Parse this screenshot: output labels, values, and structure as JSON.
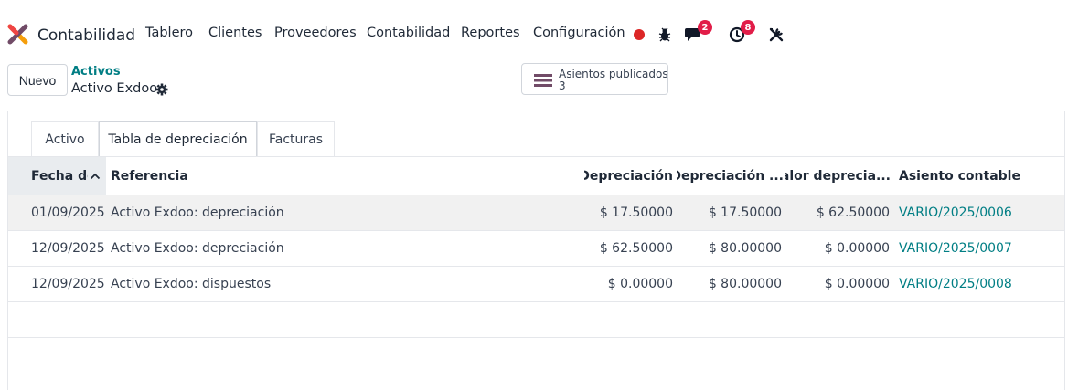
{
  "app": {
    "name": "Contabilidad"
  },
  "menu": [
    "Tablero",
    "Clientes",
    "Proveedores",
    "Contabilidad",
    "Reportes",
    "Configuración"
  ],
  "systray": {
    "messages_count": "2",
    "activities_count": "8",
    "status_color": "#dc2626"
  },
  "toolbar": {
    "new_label": "Nuevo"
  },
  "breadcrumb": {
    "parent": "Activos",
    "current": "Activo Exdoo"
  },
  "smart_button": {
    "label": "Asientos publicados",
    "value": "3"
  },
  "tabs": [
    "Activo",
    "Tabla de depreciación",
    "Facturas"
  ],
  "active_tab": "Tabla de depreciación",
  "table": {
    "columns": [
      "Fecha de",
      "Referencia",
      "Depreciación",
      "Depreciación ...",
      "Valor deprecia...",
      "Asiento contable"
    ],
    "rows": [
      {
        "date": "01/09/2025",
        "ref": "Activo Exdoo: depreciación",
        "dep": "$ 17.50000",
        "cum": "$ 17.50000",
        "rem": "$ 62.50000",
        "move": "VARIO/2025/0006"
      },
      {
        "date": "12/09/2025",
        "ref": "Activo Exdoo: depreciación",
        "dep": "$ 62.50000",
        "cum": "$ 80.00000",
        "rem": "$ 0.00000",
        "move": "VARIO/2025/0007"
      },
      {
        "date": "12/09/2025",
        "ref": "Activo Exdoo: dispuestos",
        "dep": "$ 0.00000",
        "cum": "$ 80.00000",
        "rem": "$ 0.00000",
        "move": "VARIO/2025/0008"
      }
    ]
  },
  "colors": {
    "accent": "#017e84",
    "brand_purple": "#714b67",
    "badge": "#e11d48"
  }
}
